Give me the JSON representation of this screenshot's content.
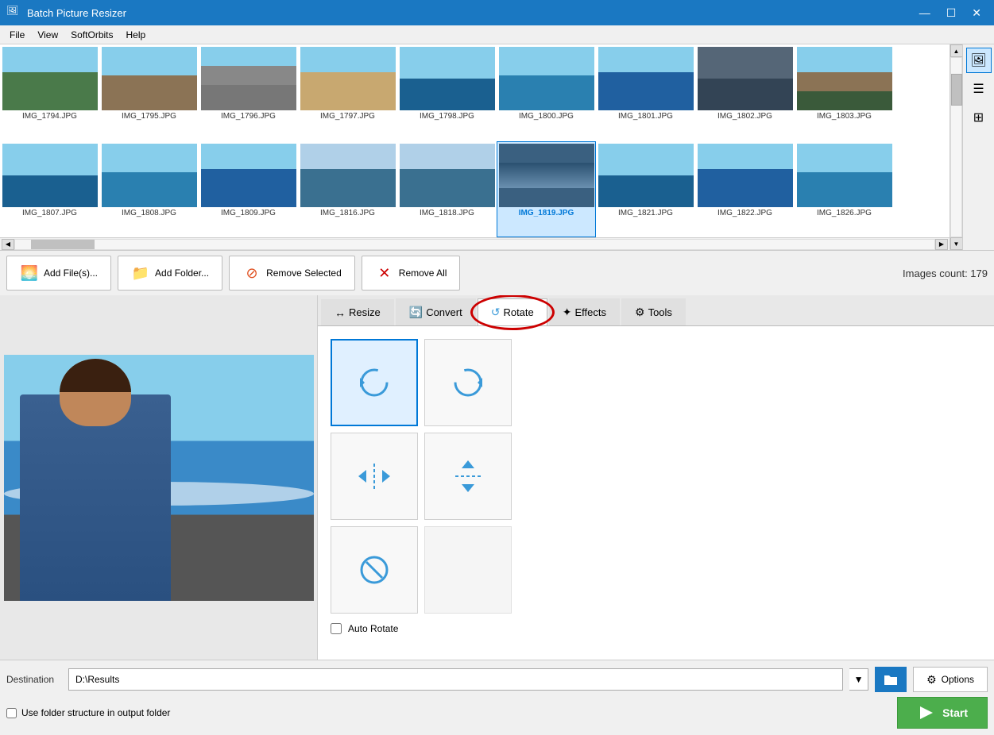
{
  "app": {
    "title": "Batch Picture Resizer",
    "icon": "🖼"
  },
  "titlebar": {
    "minimize": "—",
    "maximize": "☐",
    "close": "✕"
  },
  "menubar": {
    "items": [
      "File",
      "View",
      "SoftOrbits",
      "Help"
    ]
  },
  "toolbar": {
    "add_files_label": "Add File(s)...",
    "add_folder_label": "Add Folder...",
    "remove_selected_label": "Remove Selected",
    "remove_all_label": "Remove All",
    "images_count_label": "Images count: 179"
  },
  "thumbnails_row1": [
    {
      "name": "IMG_1794.JPG",
      "style": "img-beach1"
    },
    {
      "name": "IMG_1795.JPG",
      "style": "img-beach2"
    },
    {
      "name": "IMG_1796.JPG",
      "style": "img-street"
    },
    {
      "name": "IMG_1797.JPG",
      "style": "img-resort"
    },
    {
      "name": "IMG_1798.JPG",
      "style": "img-sea1"
    },
    {
      "name": "IMG_1800.JPG",
      "style": "img-sea2"
    },
    {
      "name": "IMG_1801.JPG",
      "style": "img-wave"
    },
    {
      "name": "IMG_1802.JPG",
      "style": "img-dark"
    },
    {
      "name": "IMG_1803.JPG",
      "style": "img-family"
    }
  ],
  "thumbnails_row2": [
    {
      "name": "IMG_1807.JPG",
      "style": "img-sea1"
    },
    {
      "name": "IMG_1808.JPG",
      "style": "img-sea2"
    },
    {
      "name": "IMG_1809.JPG",
      "style": "img-wave"
    },
    {
      "name": "IMG_1816.JPG",
      "style": "img-bottle"
    },
    {
      "name": "IMG_1818.JPG",
      "style": "img-bottle"
    },
    {
      "name": "IMG_1819.JPG",
      "style": "img-bottle",
      "selected": true
    },
    {
      "name": "IMG_1821.JPG",
      "style": "img-sea1"
    },
    {
      "name": "IMG_1822.JPG",
      "style": "img-wave"
    },
    {
      "name": "IMG_1826.JPG",
      "style": "img-sea2"
    }
  ],
  "tabs": [
    {
      "label": "Resize",
      "icon": "↔"
    },
    {
      "label": "Convert",
      "icon": "🔄"
    },
    {
      "label": "Rotate",
      "icon": "↺",
      "active": true
    },
    {
      "label": "Effects",
      "icon": "✦"
    },
    {
      "label": "Tools",
      "icon": "⚙"
    }
  ],
  "rotate_buttons": [
    {
      "icon": "↺",
      "tooltip": "Rotate 90° Counter-clockwise",
      "active": true
    },
    {
      "icon": "↻",
      "tooltip": "Rotate 90° Clockwise"
    },
    {
      "icon": "↔",
      "tooltip": "Flip Horizontal"
    },
    {
      "icon": "↕",
      "tooltip": "Flip Vertical"
    },
    {
      "icon": "⊗",
      "tooltip": "Remove Rotation"
    },
    {
      "empty": true
    }
  ],
  "auto_rotate": {
    "label": "Auto Rotate",
    "checked": false
  },
  "destination": {
    "label": "Destination",
    "value": "D:\\Results",
    "placeholder": "D:\\Results"
  },
  "footer": {
    "folder_structure_label": "Use folder structure in output folder",
    "options_label": "Options",
    "start_label": "Start"
  },
  "right_toolbar": {
    "items": [
      "🖼",
      "☰",
      "⊞"
    ]
  }
}
